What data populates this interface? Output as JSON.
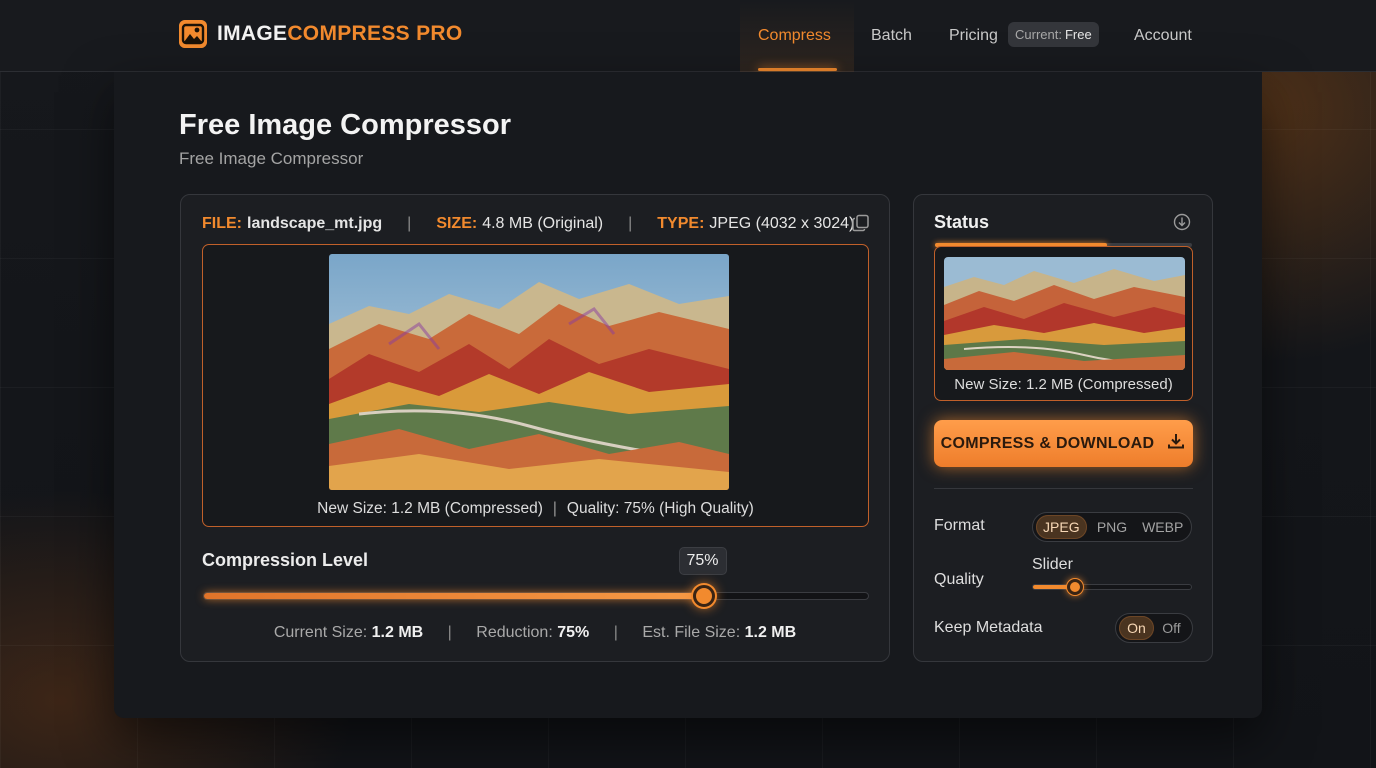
{
  "brand": {
    "name_part1": "IMAGE",
    "name_part2": "COMPRESS PRO",
    "accent": "#f28a2e"
  },
  "nav": {
    "items": [
      {
        "label": "Compress",
        "active": true
      },
      {
        "label": "Batch",
        "active": false
      },
      {
        "label": "Pricing",
        "active": false
      },
      {
        "label": "Account",
        "active": false
      }
    ],
    "plan_key": "Current:",
    "plan_value": "Free"
  },
  "page": {
    "title": "Free Image Compressor",
    "subtitle": "Free Image Compressor"
  },
  "file": {
    "file_label": "FILE:",
    "file_name": "landscape_mt.jpg",
    "size_label": "SIZE:",
    "size_value": "4.8 MB (Original)",
    "type_label": "TYPE:",
    "type_value": "JPEG (4032 x 3024)"
  },
  "preview": {
    "caption_size": "New Size: 1.2 MB (Compressed)",
    "caption_quality": "Quality: 75% (High Quality)"
  },
  "compression": {
    "label": "Compression Level",
    "value_text": "75%",
    "value_fraction": 0.75,
    "stats": {
      "current_label": "Current Size:",
      "current_value": "1.2 MB",
      "reduction_label": "Reduction:",
      "reduction_value": "75%",
      "est_label": "Est. File Size:",
      "est_value": "1.2 MB"
    }
  },
  "status": {
    "title": "Status",
    "progress_fraction": 0.67,
    "thumb_caption": "New Size: 1.2 MB (Compressed)",
    "cta_label": "COMPRESS & DOWNLOAD",
    "format_label": "Format",
    "formats": [
      "JPEG",
      "PNG",
      "WEBP"
    ],
    "format_selected": "JPEG",
    "quality_label": "Quality",
    "quality_slider_label": "Slider",
    "quality_fraction": 0.26,
    "metadata_label": "Keep Metadata",
    "metadata_on": "On",
    "metadata_off": "Off",
    "metadata_selected": "On"
  },
  "icons": {
    "logo": "image-icon",
    "copy": "copy-icon",
    "status": "download-circle-icon",
    "cta": "download-icon"
  }
}
